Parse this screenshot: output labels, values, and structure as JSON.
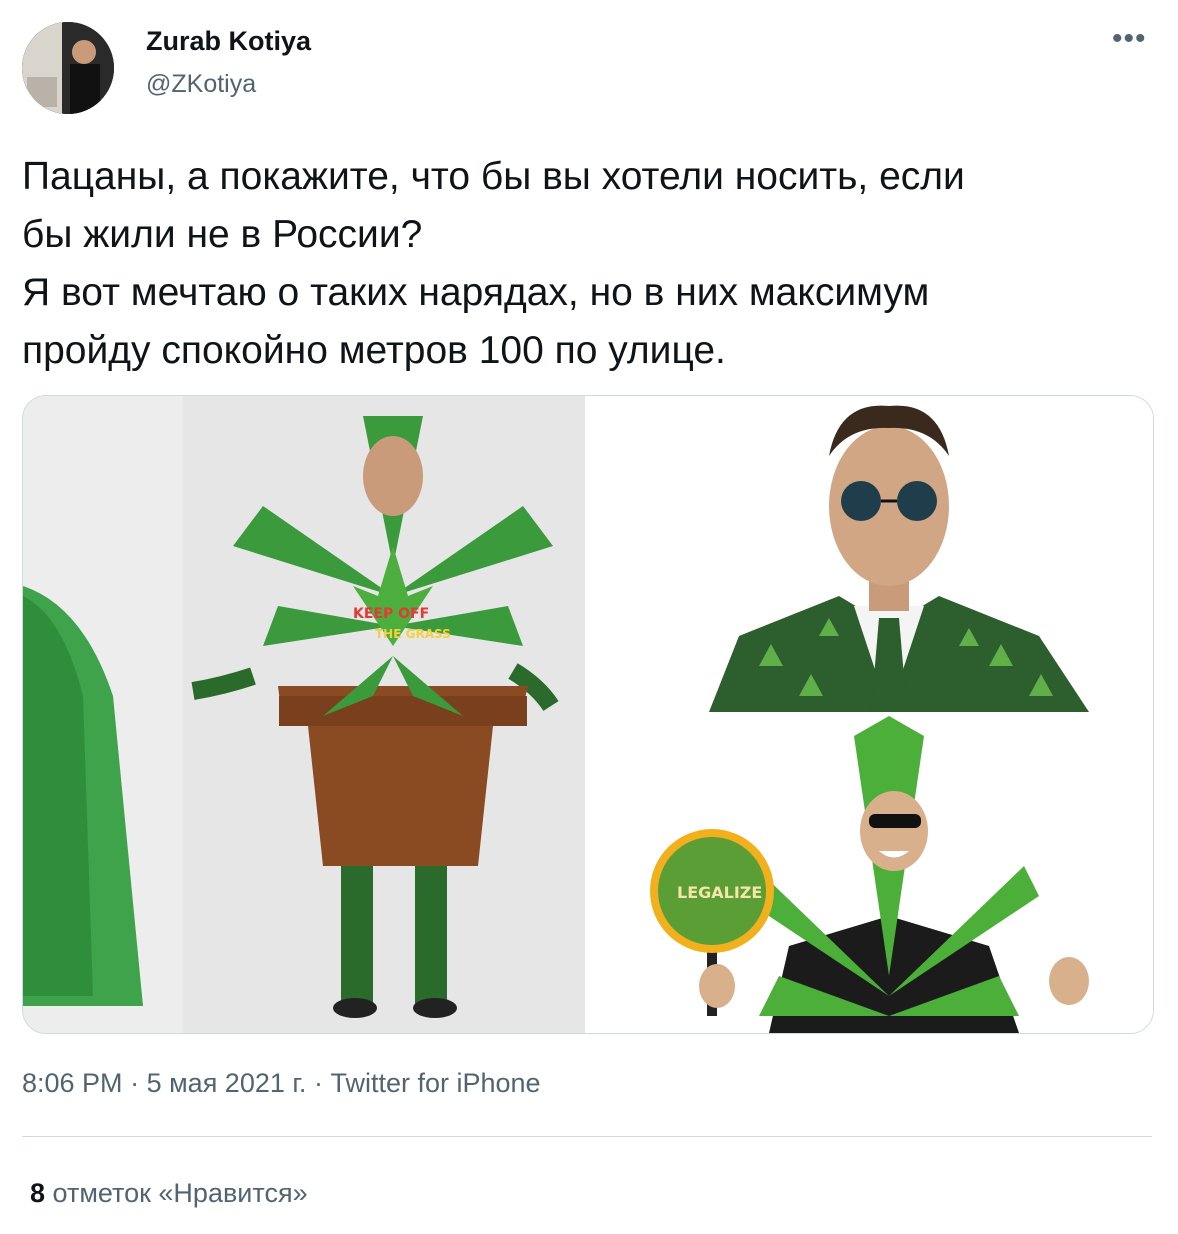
{
  "author": {
    "name": "Zurab Kotiya",
    "handle": "@ZKotiya"
  },
  "more_icon": "more-horizontal-icon",
  "tweet_text": [
    "Пацаны, а покажите, что бы вы хотели носить, если",
    "бы жили не в России?",
    "Я вот мечтаю о таких нарядах, но в них максимум",
    "пройду спокойно метров 100 по улице."
  ],
  "media": {
    "image1": {
      "sign_text_1": "KEEP OFF",
      "sign_text_2": "THE GRASS"
    },
    "image3": {
      "sign_text": "LEGALIZE"
    }
  },
  "meta": {
    "time": "8:06 PM",
    "separator": "·",
    "date": "5 мая 2021 г.",
    "source": "Twitter for iPhone"
  },
  "likes": {
    "count": "8",
    "label": "отметок «Нравится»"
  },
  "colors": {
    "leaf": "#2f8a2f",
    "pot": "#8a4a22",
    "text_secondary": "#536471",
    "border": "#cfd9de"
  }
}
